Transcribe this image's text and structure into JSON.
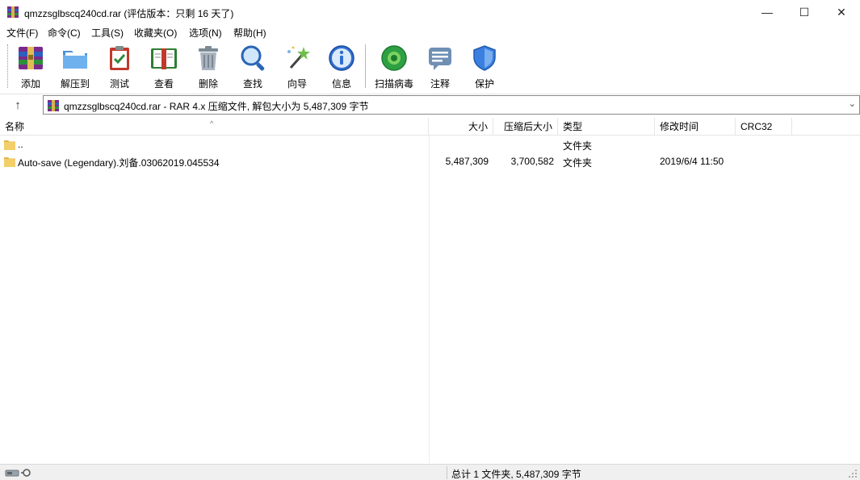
{
  "window": {
    "title": "qmzzsglbscq240cd.rar (评估版本：只剩 16 天了)",
    "minimize_glyph": "—",
    "maximize_glyph": "☐",
    "close_glyph": "✕"
  },
  "menu": [
    {
      "label": "文件(F)"
    },
    {
      "label": "命令(C)"
    },
    {
      "label": "工具(S)"
    },
    {
      "label": "收藏夹(O)"
    },
    {
      "label": "选项(N)"
    },
    {
      "label": "帮助(H)"
    }
  ],
  "toolbar": [
    {
      "label": "添加",
      "icon": "add-archive-icon"
    },
    {
      "label": "解压到",
      "icon": "extract-folder-icon"
    },
    {
      "label": "测试",
      "icon": "test-clipboard-icon"
    },
    {
      "label": "查看",
      "icon": "view-book-icon"
    },
    {
      "label": "删除",
      "icon": "trash-icon"
    },
    {
      "label": "查找",
      "icon": "magnifier-icon"
    },
    {
      "label": "向导",
      "icon": "wizard-wand-icon"
    },
    {
      "label": "信息",
      "icon": "info-icon"
    },
    {
      "label": "扫描病毒",
      "icon": "virus-scan-icon"
    },
    {
      "label": "注释",
      "icon": "comment-icon"
    },
    {
      "label": "保护",
      "icon": "shield-icon"
    }
  ],
  "address": {
    "up_glyph": "↑",
    "text": "qmzzsglbscq240cd.rar - RAR 4.x 压缩文件, 解包大小为 5,487,309 字节",
    "dropdown_glyph": "⌄"
  },
  "columns": {
    "name": "名称",
    "size": "大小",
    "packed": "压缩后大小",
    "type": "类型",
    "modified": "修改时间",
    "crc": "CRC32",
    "sort_glyph": "^"
  },
  "files": [
    {
      "name": "..",
      "size": "",
      "packed": "",
      "type": "文件夹",
      "modified": "",
      "crc": ""
    },
    {
      "name": "Auto-save (Legendary).刘备.03062019.045534",
      "size": "5,487,309",
      "packed": "3,700,582",
      "type": "文件夹",
      "modified": "2019/6/4 11:50",
      "crc": ""
    }
  ],
  "status": {
    "text": "总计 1 文件夹, 5,487,309 字节"
  },
  "colors": {
    "folder": "#f3cf6a",
    "folder_dark": "#e2b548",
    "shield": "#3b7fe0",
    "scan_green": "#2ea043"
  }
}
